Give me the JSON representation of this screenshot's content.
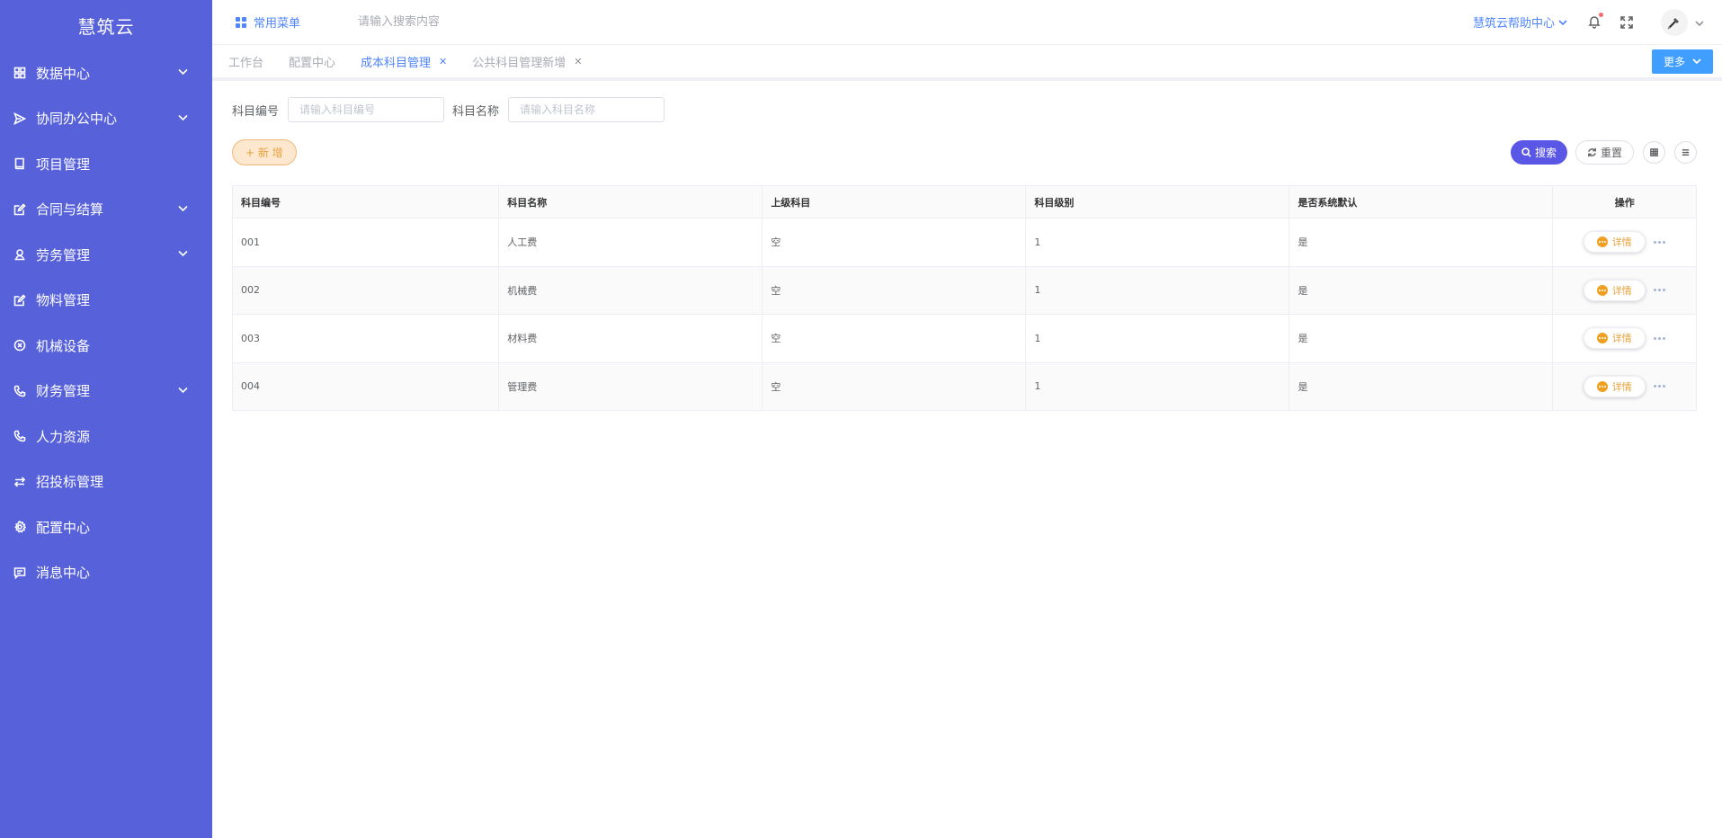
{
  "sidebar": {
    "brand": "慧筑云",
    "items": [
      {
        "label": "数据中心",
        "icon": "grid-icon",
        "expandable": true
      },
      {
        "label": "协同办公中心",
        "icon": "send-icon",
        "expandable": true
      },
      {
        "label": "项目管理",
        "icon": "book-icon",
        "expandable": false
      },
      {
        "label": "合同与结算",
        "icon": "edit-doc-icon",
        "expandable": true
      },
      {
        "label": "劳务管理",
        "icon": "worker-icon",
        "expandable": true
      },
      {
        "label": "物料管理",
        "icon": "edit-doc-icon",
        "expandable": false
      },
      {
        "label": "机械设备",
        "icon": "circle-x-icon",
        "expandable": false
      },
      {
        "label": "财务管理",
        "icon": "phone-icon",
        "expandable": true
      },
      {
        "label": "人力资源",
        "icon": "phone-icon",
        "expandable": false
      },
      {
        "label": "招投标管理",
        "icon": "exchange-icon",
        "expandable": false
      },
      {
        "label": "配置中心",
        "icon": "gear-icon",
        "expandable": false
      },
      {
        "label": "消息中心",
        "icon": "message-icon",
        "expandable": false
      }
    ]
  },
  "topbar": {
    "common_menu": "常用菜单",
    "search_placeholder": "请输入搜索内容",
    "help_center": "慧筑云帮助中心"
  },
  "tabs": [
    {
      "label": "工作台",
      "closable": false,
      "active": false
    },
    {
      "label": "配置中心",
      "closable": false,
      "active": false
    },
    {
      "label": "成本科目管理",
      "closable": true,
      "active": true
    },
    {
      "label": "公共科目管理新增",
      "closable": true,
      "active": false
    }
  ],
  "more_label": "更多",
  "filters": {
    "code_label": "科目编号",
    "code_placeholder": "请输入科目编号",
    "name_label": "科目名称",
    "name_placeholder": "请输入科目名称"
  },
  "actions": {
    "add": "+ 新 增",
    "search": "搜索",
    "reset": "重置"
  },
  "table": {
    "columns": [
      "科目编号",
      "科目名称",
      "上级科目",
      "科目级别",
      "是否系统默认",
      "操作"
    ],
    "detail_label": "详情",
    "rows": [
      [
        "001",
        "人工费",
        "空",
        "1",
        "是"
      ],
      [
        "002",
        "机械费",
        "空",
        "1",
        "是"
      ],
      [
        "003",
        "材料费",
        "空",
        "1",
        "是"
      ],
      [
        "004",
        "管理费",
        "空",
        "1",
        "是"
      ]
    ]
  },
  "colors": {
    "sidebar_bg": "#5761da",
    "primary": "#4e84ff",
    "search_btn": "#5b57e6",
    "warning": "#e6a23c"
  }
}
